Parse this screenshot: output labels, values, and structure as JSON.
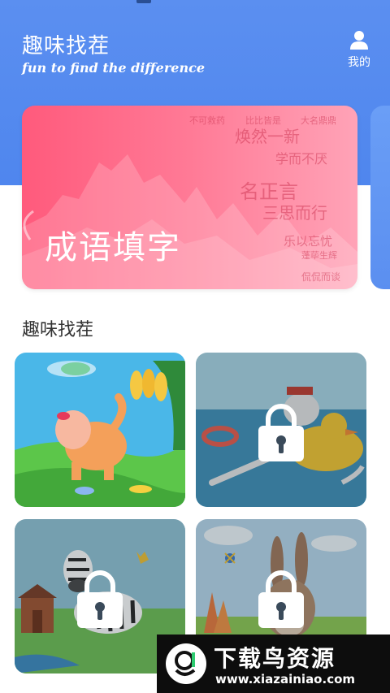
{
  "header": {
    "title": "趣味找茬",
    "subtitle": "fun to find the difference",
    "me_label": "我的"
  },
  "banner": {
    "main_text": "成语填字",
    "idioms": [
      "不可救药",
      "比比皆是",
      "大名鼎鼎",
      "焕然一新",
      "学而不厌",
      "名正言",
      "三思而行",
      "乐以忘忧",
      "蓬荜生辉",
      "侃侃而谈"
    ]
  },
  "section": {
    "title": "趣味找茬"
  },
  "levels": [
    {
      "scene": "elephant",
      "locked": false
    },
    {
      "scene": "cow-duck",
      "locked": true
    },
    {
      "scene": "zebra",
      "locked": true
    },
    {
      "scene": "rabbit",
      "locked": true
    }
  ],
  "watermark": {
    "title": "下载鸟资源",
    "url": "www.xiazainiao.com"
  },
  "colors": {
    "header_blue": "#5b8ff0",
    "banner_pink": "#ff5a7c",
    "text_dark": "#333333"
  }
}
